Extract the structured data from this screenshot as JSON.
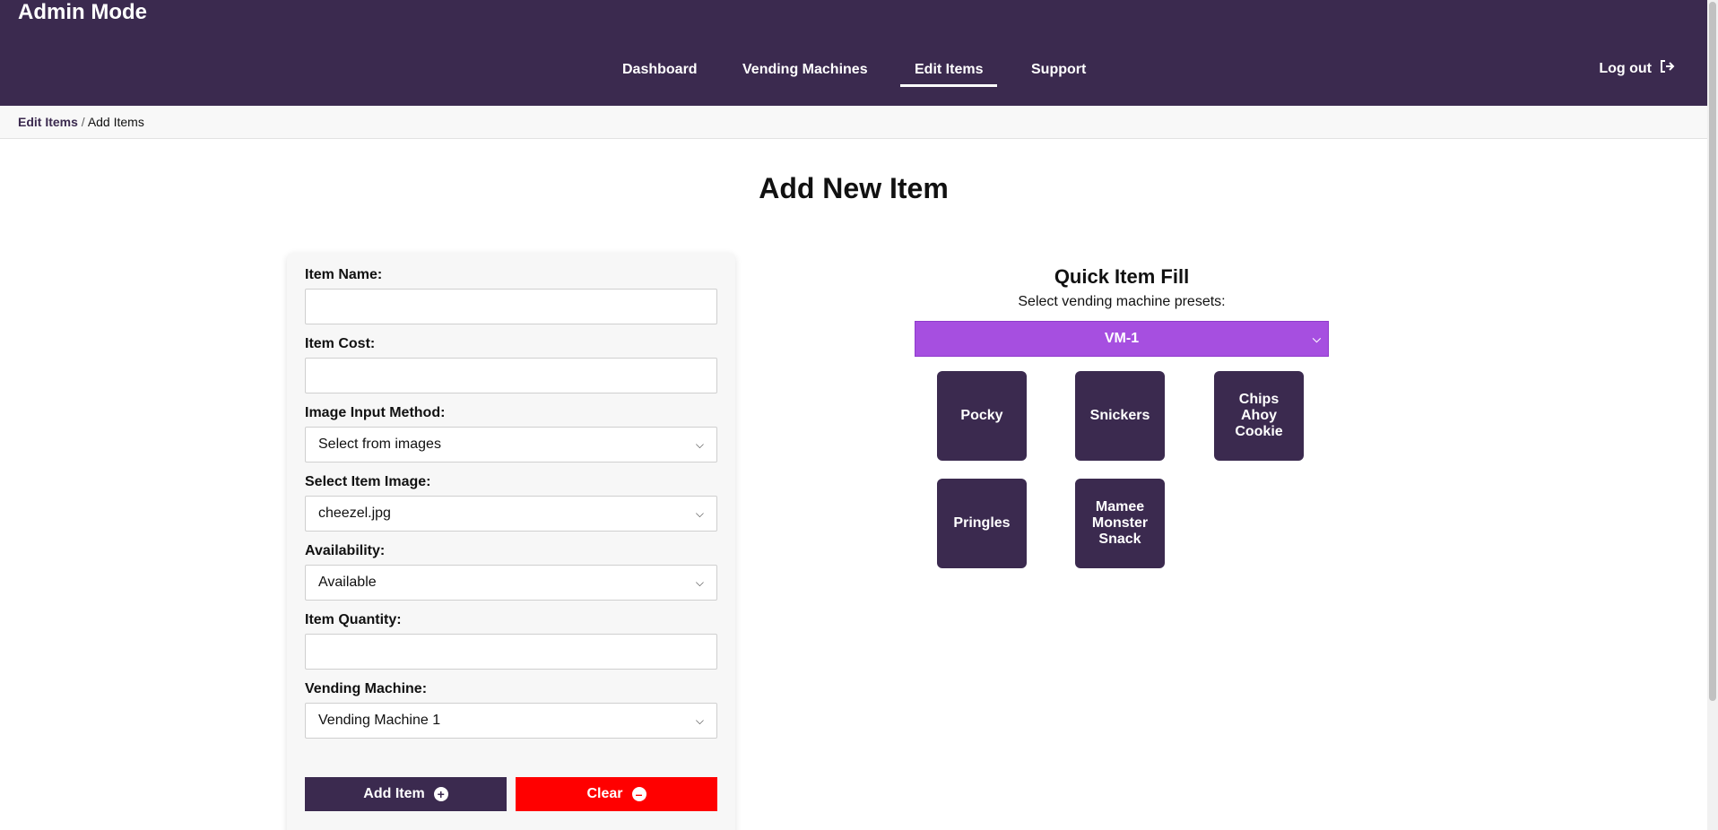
{
  "header": {
    "brand": "Admin Mode",
    "nav": [
      "Dashboard",
      "Vending Machines",
      "Edit Items",
      "Support"
    ],
    "active_nav": "Edit Items",
    "logout": "Log out"
  },
  "breadcrumb": {
    "link": "Edit Items",
    "separator": "/",
    "current": "Add Items"
  },
  "page_title": "Add New Item",
  "form": {
    "item_name": {
      "label": "Item Name:",
      "value": ""
    },
    "item_cost": {
      "label": "Item Cost:",
      "value": ""
    },
    "image_input_method": {
      "label": "Image Input Method:",
      "value": "Select from images"
    },
    "select_item_image": {
      "label": "Select Item Image:",
      "value": "cheezel.jpg"
    },
    "availability": {
      "label": "Availability:",
      "value": "Available"
    },
    "item_quantity": {
      "label": "Item Quantity:",
      "value": ""
    },
    "vending_machine": {
      "label": "Vending Machine:",
      "value": "Vending Machine 1"
    },
    "add_button": "Add Item",
    "clear_button": "Clear"
  },
  "quick_fill": {
    "title": "Quick Item Fill",
    "subtitle": "Select vending machine presets:",
    "selected_preset": "VM-1",
    "items": [
      "Pocky",
      "Snickers",
      "Chips Ahoy Cookie",
      "Pringles",
      "Mamee Monster Snack"
    ]
  },
  "colors": {
    "header_bg": "#3b2a4f",
    "preset_select_bg": "#a64fe0",
    "clear_button_bg": "#ff0000",
    "add_button_bg": "#3b2a4f"
  },
  "icons": {
    "logout": "logout-icon",
    "add": "plus-circle-icon",
    "clear": "minus-circle-icon",
    "dropdown": "chevron-down-icon"
  }
}
